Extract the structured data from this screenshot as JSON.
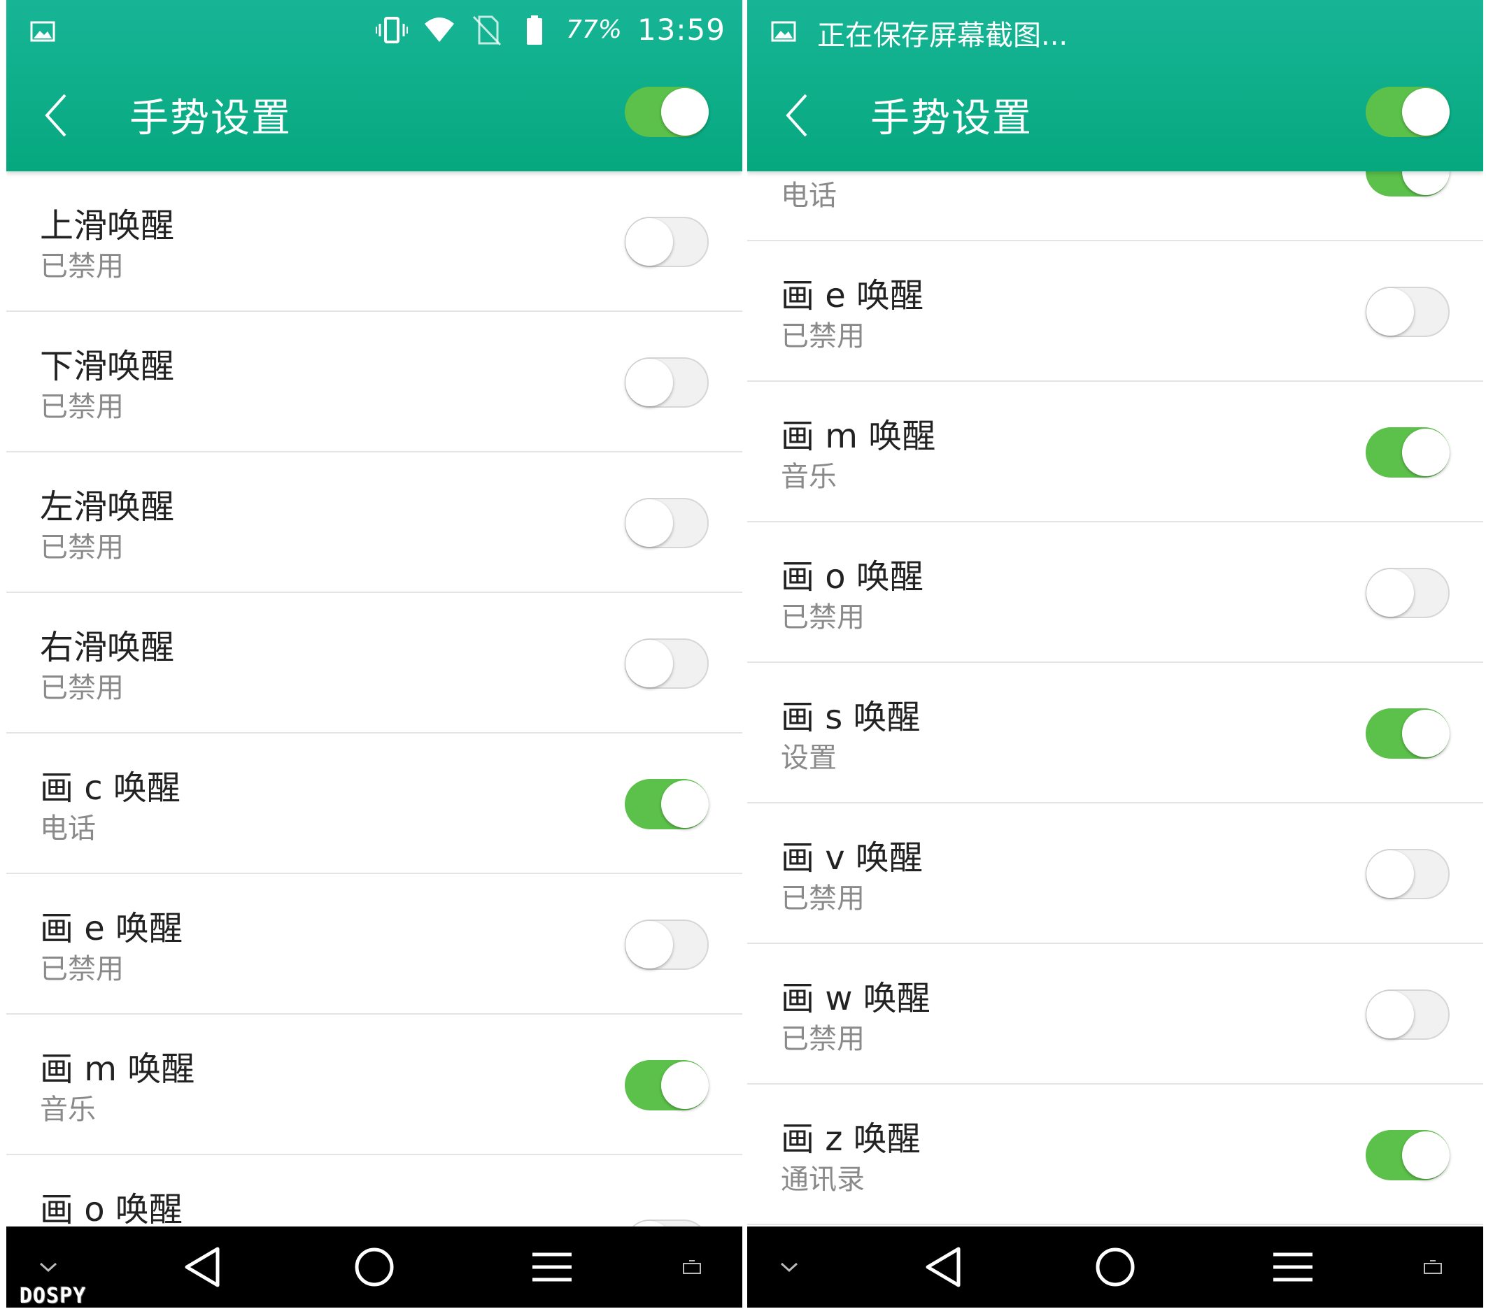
{
  "colors": {
    "appbar": "#0cae89",
    "switch_on": "#5cc14a",
    "switch_off": "#f1f1f1",
    "title_text": "#222222",
    "subtitle_text": "#8a8a8a",
    "navbar": "#000000"
  },
  "left": {
    "status": {
      "icons": [
        "image-icon",
        "vibrate-icon",
        "wifi-icon",
        "no-sim-icon",
        "battery-icon"
      ],
      "battery": "77%",
      "time": "13:59"
    },
    "title": "手势设置",
    "master_enabled": true,
    "items": [
      {
        "title": "上滑唤醒",
        "subtitle": "已禁用",
        "enabled": false
      },
      {
        "title": "下滑唤醒",
        "subtitle": "已禁用",
        "enabled": false
      },
      {
        "title": "左滑唤醒",
        "subtitle": "已禁用",
        "enabled": false
      },
      {
        "title": "右滑唤醒",
        "subtitle": "已禁用",
        "enabled": false
      },
      {
        "title": "画 c 唤醒",
        "subtitle": "电话",
        "enabled": true
      },
      {
        "title": "画 e 唤醒",
        "subtitle": "已禁用",
        "enabled": false
      },
      {
        "title": "画 m 唤醒",
        "subtitle": "音乐",
        "enabled": true
      },
      {
        "title": "画 o 唤醒",
        "subtitle": "",
        "enabled": false
      }
    ]
  },
  "right": {
    "status": {
      "icons": [
        "image-icon"
      ],
      "caption": "正在保存屏幕截图..."
    },
    "title": "手势设置",
    "master_enabled": true,
    "items": [
      {
        "title": "",
        "subtitle": "电话",
        "enabled": true
      },
      {
        "title": "画 e 唤醒",
        "subtitle": "已禁用",
        "enabled": false
      },
      {
        "title": "画 m 唤醒",
        "subtitle": "音乐",
        "enabled": true
      },
      {
        "title": "画 o 唤醒",
        "subtitle": "已禁用",
        "enabled": false
      },
      {
        "title": "画 s 唤醒",
        "subtitle": "设置",
        "enabled": true
      },
      {
        "title": "画 v 唤醒",
        "subtitle": "已禁用",
        "enabled": false
      },
      {
        "title": "画 w 唤醒",
        "subtitle": "已禁用",
        "enabled": false
      },
      {
        "title": "画 z 唤醒",
        "subtitle": "通讯录",
        "enabled": true
      }
    ]
  },
  "navbar": {
    "icons": [
      "chevron-down-icon",
      "back-icon",
      "home-icon",
      "menu-icon",
      "screenshot-icon"
    ]
  },
  "watermark": "DOSPY"
}
